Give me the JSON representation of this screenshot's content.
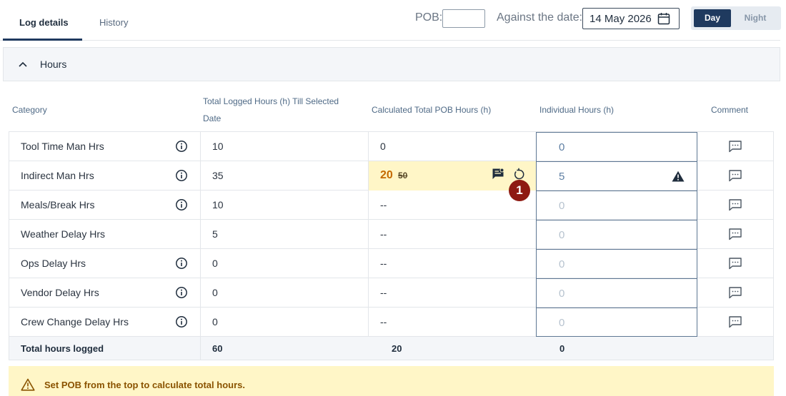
{
  "tabs": [
    {
      "label": "Log details",
      "active": true
    },
    {
      "label": "History",
      "active": false
    }
  ],
  "header": {
    "pob_label": "POB:",
    "pob_value": "",
    "date_label": "Against the date:",
    "date_value": "14 May 2026",
    "shift_options": [
      "Day",
      "Night"
    ],
    "shift_selected": "Day"
  },
  "section": {
    "title": "Hours",
    "expanded": true
  },
  "columns": {
    "category": "Category",
    "total_logged": "Total Logged Hours (h) Till Selected Date",
    "total_logged_line1": "Total Logged Hours (h) Till Selected",
    "total_logged_line2": "Date",
    "calculated": "Calculated Total POB Hours (h)",
    "individual": "Individual Hours (h)",
    "comment": "Comment"
  },
  "rows": [
    {
      "category": "Tool Time Man Hrs",
      "has_info": true,
      "total_logged": "10",
      "calculated": "0",
      "individual": "0"
    },
    {
      "category": "Indirect Man Hrs",
      "has_info": true,
      "total_logged": "35",
      "calculated": "20",
      "calculated_previous": "50",
      "individual": "5",
      "warning": true
    },
    {
      "category": "Meals/Break Hrs",
      "has_info": true,
      "total_logged": "10",
      "calculated": "--",
      "individual": "0"
    },
    {
      "category": "Weather Delay Hrs",
      "has_info": false,
      "total_logged": "5",
      "calculated": "--",
      "individual": "0"
    },
    {
      "category": "Ops Delay Hrs",
      "has_info": true,
      "total_logged": "0",
      "calculated": "--",
      "individual": "0"
    },
    {
      "category": "Vendor Delay Hrs",
      "has_info": true,
      "total_logged": "0",
      "calculated": "--",
      "individual": "0"
    },
    {
      "category": "Crew Change Delay Hrs",
      "has_info": true,
      "total_logged": "0",
      "calculated": "--",
      "individual": "0"
    }
  ],
  "totals": {
    "label": "Total hours logged",
    "total_logged": "60",
    "calculated": "20",
    "individual": "0"
  },
  "step_badge": "1",
  "banner": {
    "text": "Set POB from the top to calculate total hours."
  },
  "colors": {
    "primary": "#1f3a5f",
    "highlight": "#fff6c7",
    "changed_value": "#c46a00",
    "badge": "#8e1a12",
    "individual_active": "#5e7fa3",
    "individual_muted": "#b7c3cf"
  }
}
